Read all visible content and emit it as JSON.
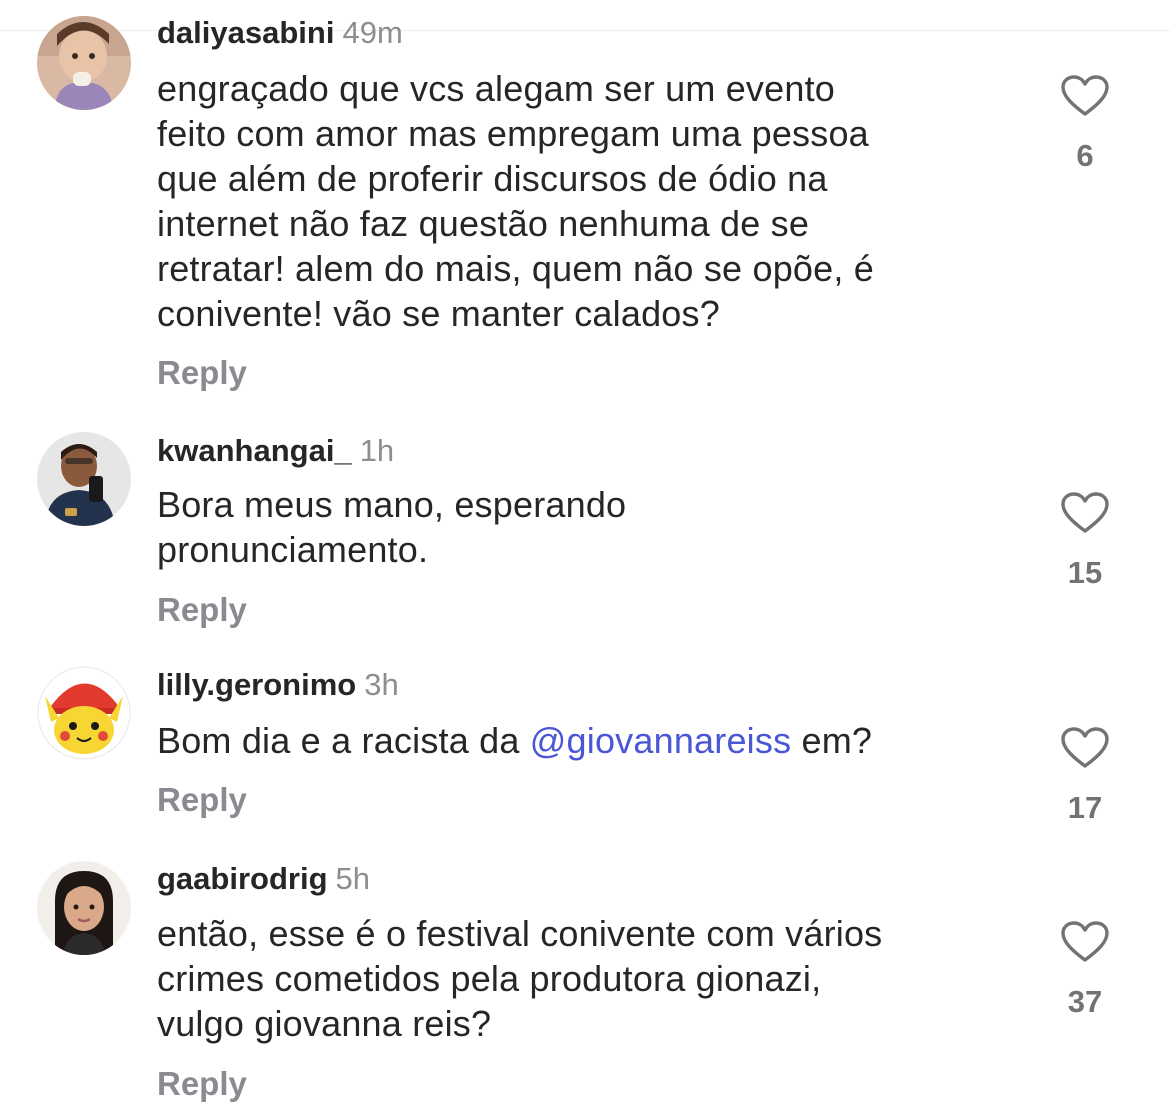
{
  "comments": [
    {
      "username": "daliyasabini",
      "time": "49m",
      "lines": [
        "engraçado que vcs alegam ser um evento",
        "feito com amor mas empregam uma pessoa",
        "que além de proferir discursos de ódio na",
        "internet não faz questão nenhuma de se",
        "retratar! alem do mais, quem não se opõe, é",
        "conivente! vão se manter calados?"
      ],
      "reply_label": "Reply",
      "like_icon": "heart-outline-icon",
      "like_count": "6"
    },
    {
      "username": "kwanhangai_",
      "time": "1h",
      "lines": [
        "Bora meus mano, esperando",
        "pronunciamento."
      ],
      "reply_label": "Reply",
      "like_icon": "heart-outline-icon",
      "like_count": "15"
    },
    {
      "username": "lilly.geronimo",
      "time": "3h",
      "text_before": "Bom dia e a racista da ",
      "mention": "@giovannareiss",
      "text_after": " em?",
      "reply_label": "Reply",
      "like_icon": "heart-outline-icon",
      "like_count": "17"
    },
    {
      "username": "gaabirodrig",
      "time": "5h",
      "lines": [
        "então, esse é o festival conivente com vários",
        "crimes cometidos pela produtora gionazi,",
        "vulgo giovanna reis?"
      ],
      "reply_label": "Reply",
      "like_icon": "heart-outline-icon",
      "like_count": "37"
    }
  ],
  "colors": {
    "text": "#262626",
    "secondary": "#8e8e8e",
    "reply": "#8a8a90",
    "mention": "#4a56d6"
  }
}
